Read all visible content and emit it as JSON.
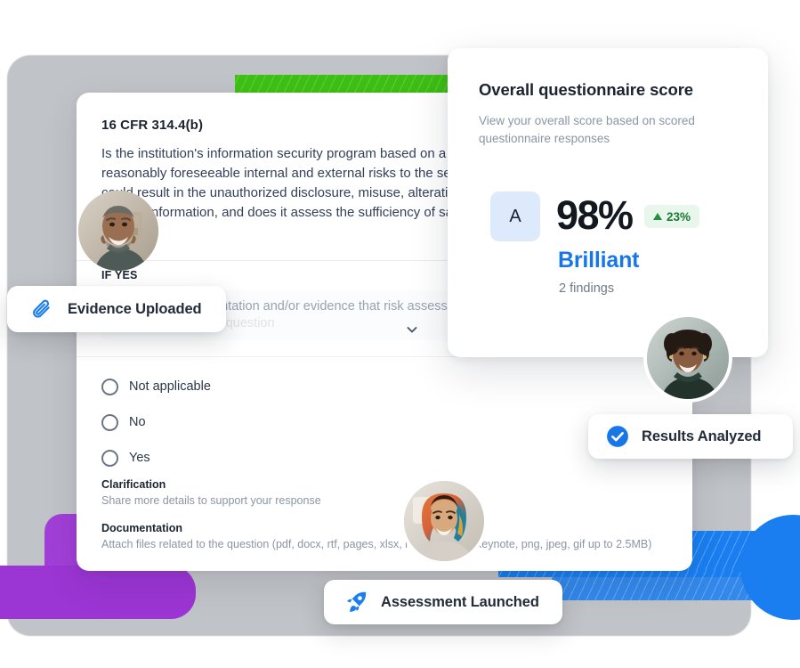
{
  "question_card": {
    "code": "16 CFR 314.4(b)",
    "question": "Is the institution's information security program based on a risk assessment that identifies reasonably foreseeable internal and external risks to the security of customer information that could result in the unauthorized disclosure, misuse, alteration, destruction, or other compromise of such information, and does it assess the sufficiency of safeguards in place to control these risks?",
    "if_yes_label": "IF YES",
    "select": {
      "line1": "Select the documentation and/or evidence that risk assessment",
      "line2": "is based on for this question",
      "chevron_icon": "chevron-down-icon"
    },
    "radio_options": [
      {
        "label": "Not applicable",
        "selected": false
      },
      {
        "label": "No",
        "selected": false
      },
      {
        "label": "Yes",
        "selected": false
      }
    ],
    "clarification": {
      "title": "Clarification",
      "description": "Share more details to support your response"
    },
    "documentation": {
      "title": "Documentation",
      "description": "Attach files related to the question (pdf, docx, rtf, pages, xlsx, numbers, ppt, keynote, png, jpeg, gif up to 2.5MB)"
    }
  },
  "score_card": {
    "title": "Overall questionnaire score",
    "subtitle": "View your overall score based on scored questionnaire responses",
    "grade": "A",
    "percent": "98%",
    "delta": "23%",
    "delta_direction_icon": "triangle-up-icon",
    "rating_word": "Brilliant",
    "findings": "2 findings"
  },
  "badges": [
    {
      "label": "Evidence Uploaded",
      "icon": "paperclip-icon"
    },
    {
      "label": "Results Analyzed",
      "icon": "check-circle-icon"
    },
    {
      "label": "Assessment Launched",
      "icon": "rocket-icon"
    }
  ],
  "avatars": [
    {
      "name": "avatar-smiling-man"
    },
    {
      "name": "avatar-smiling-woman"
    },
    {
      "name": "avatar-woman-headscarf"
    }
  ],
  "colors": {
    "accent_blue": "#1877e8",
    "success_green": "#1a7a32",
    "grade_chip_bg": "#ddeafb",
    "stripe_green": "#3ec016",
    "stripe_blue": "#1a7ef0",
    "shape_purple": "#9b35d4"
  }
}
